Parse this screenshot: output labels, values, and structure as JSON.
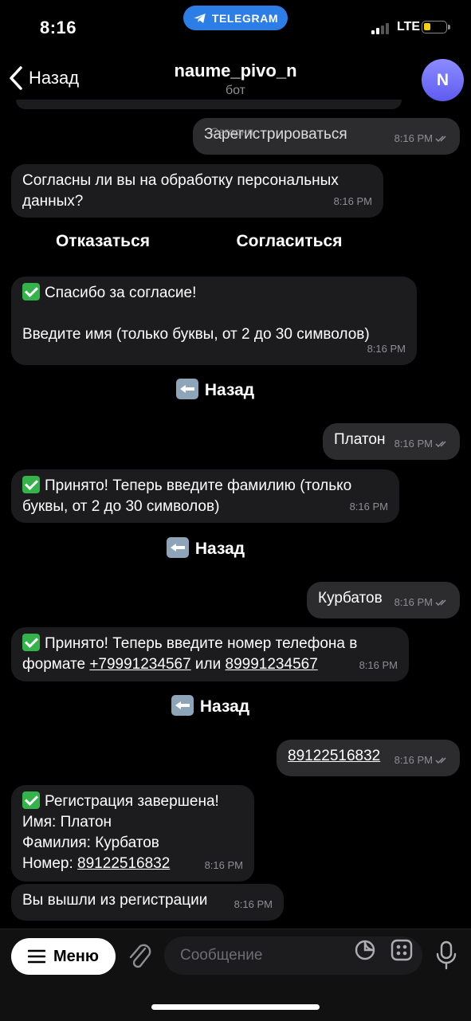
{
  "status_bar": {
    "time": "8:16",
    "app_pill": "TELEGRAM",
    "network": "LTE"
  },
  "header": {
    "back_label": "Назад",
    "title": "naume_pivo_n",
    "subtitle": "бот",
    "avatar_letter": "N"
  },
  "chat": {
    "date_label": "Сегодня",
    "messages": [
      {
        "dir": "out",
        "text": "Зарегистрироваться",
        "time": "8:16 PM"
      },
      {
        "dir": "in",
        "text": "Согласны ли вы на обработку персональных данных?",
        "time": "8:16 PM"
      },
      {
        "dir": "in",
        "line1": "Спасибо за согласие!",
        "line2": "Введите имя (только буквы, от 2 до 30 символов)",
        "time": "8:16 PM"
      },
      {
        "dir": "out",
        "text": "Платон",
        "time": "8:16 PM"
      },
      {
        "dir": "in",
        "text": "Принято! Теперь введите фамилию (только буквы, от 2 до 30 символов)",
        "time": "8:16 PM"
      },
      {
        "dir": "out",
        "text": "Курбатов",
        "time": "8:16 PM"
      },
      {
        "dir": "in",
        "text_before": "Принято! Теперь введите номер телефона в формате ",
        "phone1": "+79991234567",
        "text_mid": " или ",
        "phone2": "89991234567",
        "time": "8:16 PM"
      },
      {
        "dir": "out",
        "text": "89122516832",
        "time": "8:16 PM"
      },
      {
        "dir": "in",
        "line1": "Регистрация завершена!",
        "line2": "Имя: Платон",
        "line3": "Фамилия: Курбатов",
        "line4_label": "Номер: ",
        "line4_value": "89122516832",
        "time": "8:16 PM"
      },
      {
        "dir": "in",
        "text": "Вы вышли из регистрации",
        "time": "8:16 PM"
      }
    ],
    "keyboards": {
      "consent": {
        "decline": "Отказаться",
        "accept": "Согласиться"
      },
      "back": "Назад"
    }
  },
  "input_bar": {
    "menu_label": "Меню",
    "placeholder": "Сообщение"
  },
  "colors": {
    "accent": "#2c7ee6",
    "bubble_in": "#1c1c1e",
    "bubble_out": "#2c2c2e",
    "check": "#34b34a",
    "avatar": "#6f6cf5"
  }
}
